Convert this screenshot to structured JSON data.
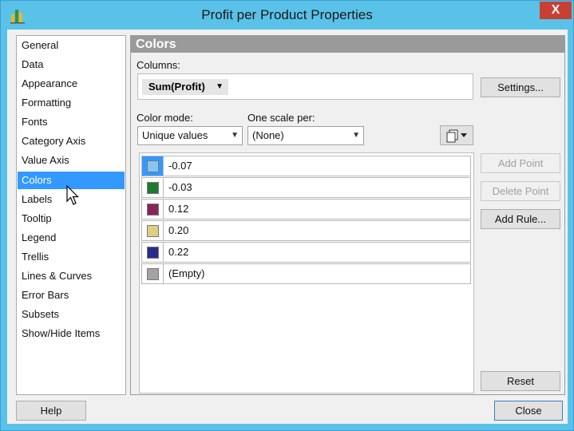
{
  "window": {
    "title": "Profit per Product Properties",
    "close_label": "X"
  },
  "nav": {
    "items": [
      {
        "label": "General"
      },
      {
        "label": "Data"
      },
      {
        "label": "Appearance"
      },
      {
        "label": "Formatting"
      },
      {
        "label": "Fonts"
      },
      {
        "label": "Category Axis"
      },
      {
        "label": "Value Axis"
      },
      {
        "label": "Colors"
      },
      {
        "label": "Labels"
      },
      {
        "label": "Tooltip"
      },
      {
        "label": "Legend"
      },
      {
        "label": "Trellis"
      },
      {
        "label": "Lines & Curves"
      },
      {
        "label": "Error Bars"
      },
      {
        "label": "Subsets"
      },
      {
        "label": "Show/Hide Items"
      }
    ],
    "selected": "Colors"
  },
  "panel": {
    "header": "Colors",
    "columns_label": "Columns:",
    "column_chip": "Sum(Profit)",
    "settings_button": "Settings...",
    "color_mode_label": "Color mode:",
    "color_mode_value": "Unique values",
    "one_scale_label": "One scale per:",
    "one_scale_value": "(None)",
    "add_point_button": "Add Point",
    "delete_point_button": "Delete Point",
    "add_rule_button": "Add Rule...",
    "reset_button": "Reset",
    "color_rows": [
      {
        "value": "-0.07",
        "color": "#87c6ec"
      },
      {
        "value": "-0.03",
        "color": "#1e7a2e"
      },
      {
        "value": "0.12",
        "color": "#8a2456"
      },
      {
        "value": "0.20",
        "color": "#e0cd84"
      },
      {
        "value": "0.22",
        "color": "#2b2a8c"
      },
      {
        "value": "(Empty)",
        "color": "#a3a3a3"
      }
    ]
  },
  "footer": {
    "help_button": "Help",
    "close_button": "Close"
  }
}
